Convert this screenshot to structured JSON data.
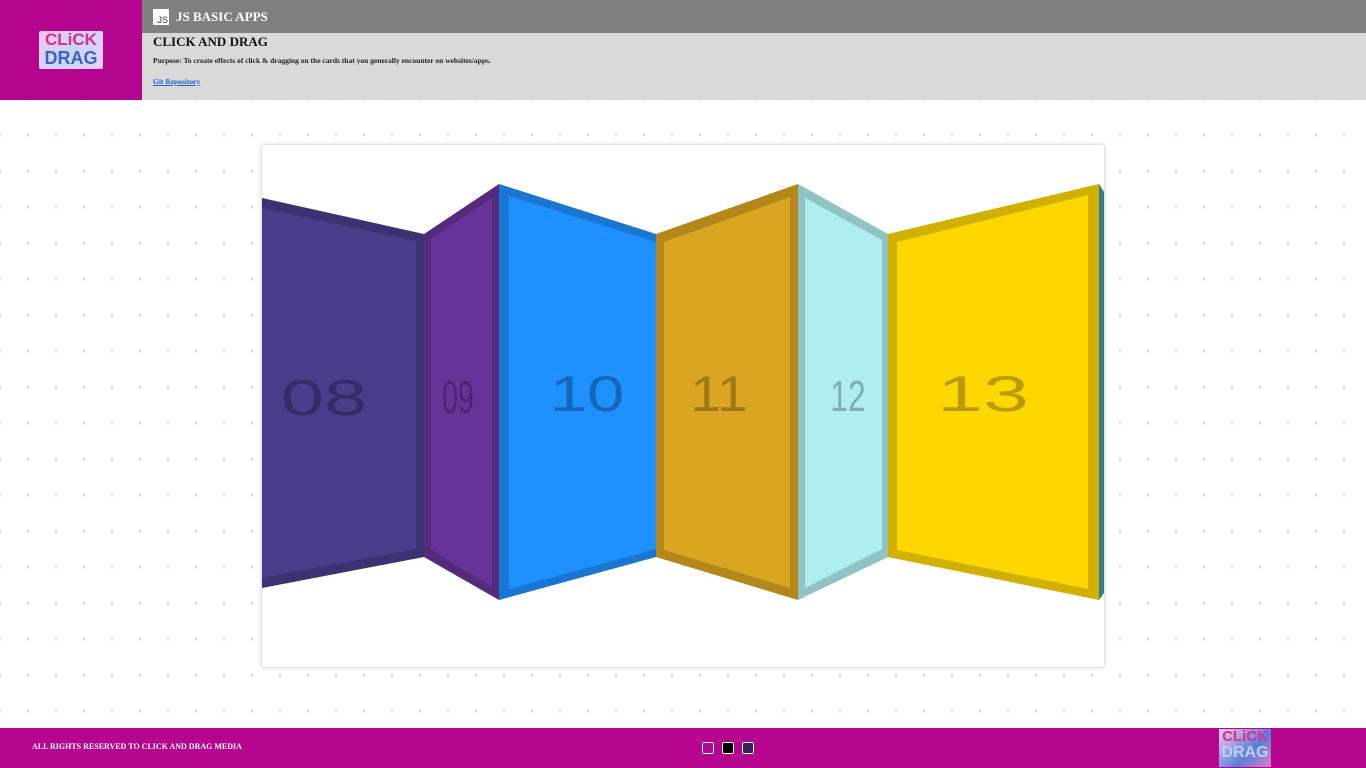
{
  "header": {
    "logo": {
      "line1": "CLiCK",
      "line2": "DRAG"
    },
    "badge": "JS",
    "app_name": "JS BASIC APPS",
    "title": "CLICK AND DRAG",
    "purpose": "Purpose: To create effects of click & dragging on the cards that you generally encounter on websites/apps.",
    "link": "Git Repository"
  },
  "cards": [
    {
      "label": "08",
      "color": "#483d8b"
    },
    {
      "label": "09",
      "color": "#663399"
    },
    {
      "label": "10",
      "color": "#1e90ff"
    },
    {
      "label": "11",
      "color": "#daa520"
    },
    {
      "label": "12",
      "color": "#afeeee"
    },
    {
      "label": "13",
      "color": "#ffd700"
    }
  ],
  "footer": {
    "copyright": "ALL RIGHTS RESERVED TO CLICK AND DRAG MEDIA",
    "theme_dots": [
      "magenta-theme-button",
      "black-theme-button",
      "purple-theme-button"
    ],
    "logo": {
      "line1": "CLiCK",
      "line2": "DRAG"
    }
  }
}
